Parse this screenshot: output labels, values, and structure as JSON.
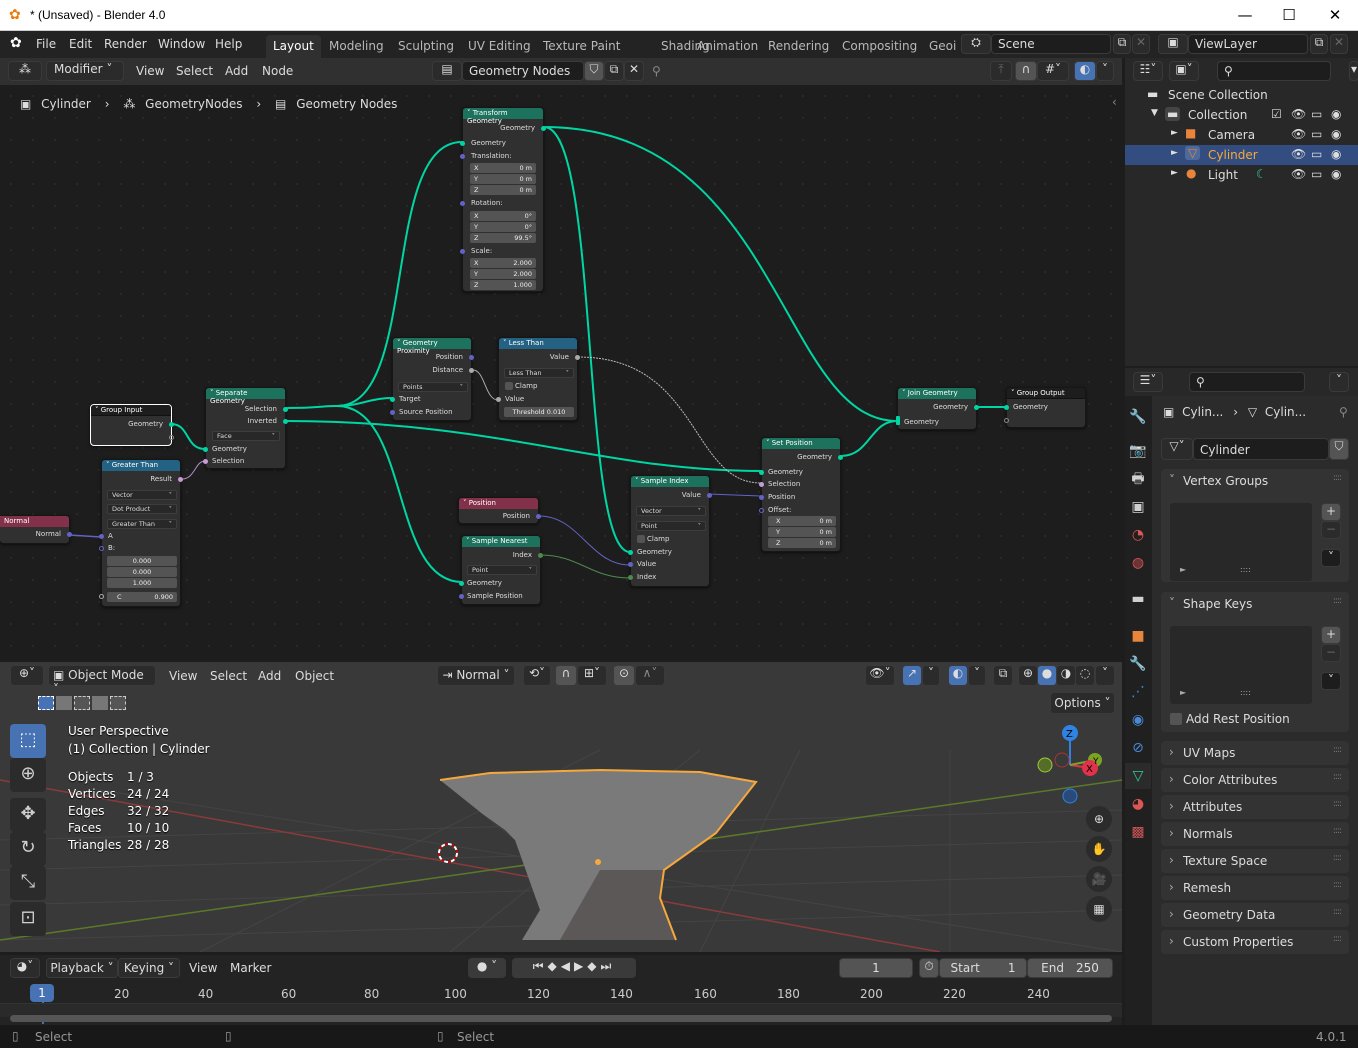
{
  "window": {
    "title": "* (Unsaved) - Blender 4.0",
    "minimize": "—",
    "maximize": "☐",
    "close": "✕"
  },
  "topbar": {
    "menus": [
      "File",
      "Edit",
      "Render",
      "Window",
      "Help"
    ],
    "workspaces": [
      "Layout",
      "Modeling",
      "Sculpting",
      "UV Editing",
      "Texture Paint",
      "Shading",
      "Animation",
      "Rendering",
      "Compositing",
      "Geoi"
    ],
    "active_workspace": "Layout",
    "scene": "Scene",
    "view_layer": "ViewLayer"
  },
  "node_editor": {
    "context": "Modifier",
    "menus": [
      "View",
      "Select",
      "Add",
      "Node"
    ],
    "node_group": "Geometry Nodes",
    "breadcrumb": [
      "Cylinder",
      "GeometryNodes",
      "Geometry Nodes"
    ],
    "nodes": {
      "transform": {
        "title": "Transform Geometry",
        "out": "Geometry",
        "in_geo": "Geometry",
        "translation": "Translation:",
        "rotation": "Rotation:",
        "scale": "Scale:",
        "t": [
          [
            "X",
            "0 m"
          ],
          [
            "Y",
            "0 m"
          ],
          [
            "Z",
            "0 m"
          ]
        ],
        "r": [
          [
            "X",
            "0°"
          ],
          [
            "Y",
            "0°"
          ],
          [
            "Z",
            "99.5°"
          ]
        ],
        "s": [
          [
            "X",
            "2.000"
          ],
          [
            "Y",
            "2.000"
          ],
          [
            "Z",
            "1.000"
          ]
        ]
      },
      "proximity": {
        "title": "Geometry Proximity",
        "position": "Position",
        "distance": "Distance",
        "mode": "Points",
        "target": "Target",
        "source": "Source Position"
      },
      "less_than": {
        "title": "Less Than",
        "value_out": "Value",
        "op": "Less Than",
        "clamp": "Clamp",
        "value_in": "Value",
        "threshold": "Threshold",
        "threshold_val": "0.010"
      },
      "group_input": {
        "title": "Group Input",
        "geometry": "Geometry"
      },
      "separate": {
        "title": "Separate Geometry",
        "selection_out": "Selection",
        "inverted": "Inverted",
        "domain": "Face",
        "geometry": "Geometry",
        "selection_in": "Selection"
      },
      "greater_than": {
        "title": "Greater Than",
        "result": "Result",
        "type": "Vector",
        "mode": "Dot Product",
        "op": "Greater Than",
        "a": "A",
        "b": "B:",
        "b_vals": [
          "0.000",
          "0.000",
          "1.000"
        ],
        "c": "C",
        "c_val": "0.900"
      },
      "normal": {
        "title": "Normal",
        "out": "Normal"
      },
      "position": {
        "title": "Position",
        "out": "Position"
      },
      "sample_nearest": {
        "title": "Sample Nearest",
        "index": "Index",
        "domain": "Point",
        "geometry": "Geometry",
        "sample_pos": "Sample Position"
      },
      "sample_index": {
        "title": "Sample Index",
        "value_out": "Value",
        "type": "Vector",
        "domain": "Point",
        "clamp": "Clamp",
        "geometry": "Geometry",
        "value_in": "Value",
        "index": "Index"
      },
      "set_position": {
        "title": "Set Position",
        "out": "Geometry",
        "geometry": "Geometry",
        "selection": "Selection",
        "position": "Position",
        "offset": "Offset:",
        "o": [
          [
            "X",
            "0 m"
          ],
          [
            "Y",
            "0 m"
          ],
          [
            "Z",
            "0 m"
          ]
        ]
      },
      "join": {
        "title": "Join Geometry",
        "out": "Geometry",
        "in": "Geometry"
      },
      "group_output": {
        "title": "Group Output",
        "geometry": "Geometry"
      }
    }
  },
  "viewport": {
    "mode": "Object Mode",
    "menus": [
      "View",
      "Select",
      "Add",
      "Object"
    ],
    "orientation": "Normal",
    "options": "Options",
    "perspective": "User Perspective",
    "collection": "(1) Collection | Cylinder",
    "stats": [
      [
        "Objects",
        "1 / 3"
      ],
      [
        "Vertices",
        "24 / 24"
      ],
      [
        "Edges",
        "32 / 32"
      ],
      [
        "Faces",
        "10 / 10"
      ],
      [
        "Triangles",
        "28 / 28"
      ]
    ],
    "gizmo": {
      "x": "X",
      "y": "Y",
      "z": "Z"
    }
  },
  "timeline": {
    "menus": [
      "Playback",
      "Keying",
      "View",
      "Marker"
    ],
    "current_frame": "1",
    "start_label": "Start",
    "start": "1",
    "end_label": "End",
    "end": "250",
    "ticks": [
      "20",
      "40",
      "60",
      "80",
      "100",
      "120",
      "140",
      "160",
      "180",
      "200",
      "220",
      "240"
    ],
    "playhead": "1"
  },
  "outliner": {
    "root": "Scene Collection",
    "collection": "Collection",
    "items": [
      {
        "name": "Camera",
        "icon": "camera"
      },
      {
        "name": "Cylinder",
        "icon": "mesh",
        "selected": true
      },
      {
        "name": "Light",
        "icon": "light"
      }
    ]
  },
  "properties": {
    "crumb1": "Cylin...",
    "crumb2": "Cylin...",
    "mesh_name": "Cylinder",
    "vertex_groups": "Vertex Groups",
    "shape_keys": "Shape Keys",
    "add_rest": "Add Rest Position",
    "panels": [
      "UV Maps",
      "Color Attributes",
      "Attributes",
      "Normals",
      "Texture Space",
      "Remesh",
      "Geometry Data",
      "Custom Properties"
    ]
  },
  "statusbar": {
    "left": "Select",
    "right": "Select",
    "version": "4.0.1"
  },
  "colors": {
    "geometry_link": "#00d6a3",
    "accent": "#4772b3",
    "selected_text": "#f5a83b"
  }
}
